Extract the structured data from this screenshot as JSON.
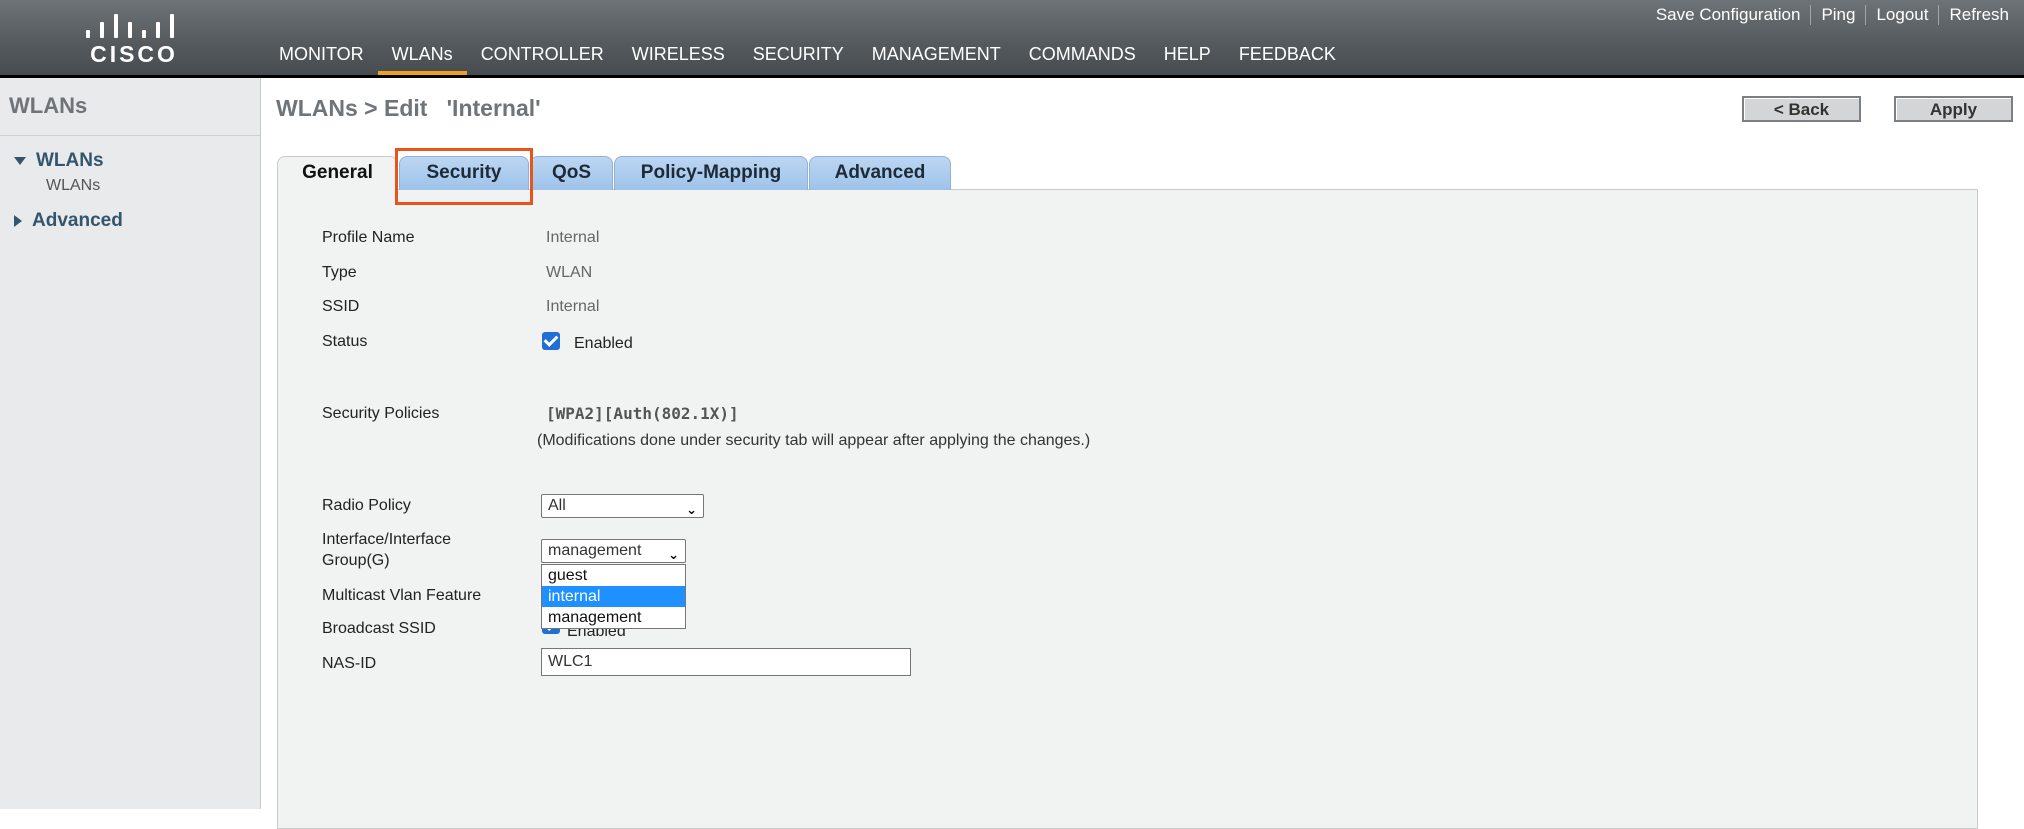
{
  "header": {
    "logo_text": "CISCO",
    "utility_links": [
      "Save Configuration",
      "Ping",
      "Logout",
      "Refresh"
    ],
    "nav": [
      "MONITOR",
      "WLANs",
      "CONTROLLER",
      "WIRELESS",
      "SECURITY",
      "MANAGEMENT",
      "COMMANDS",
      "HELP",
      "FEEDBACK"
    ],
    "active_nav": "WLANs",
    "accent_color": "#f0a020"
  },
  "sidebar": {
    "title": "WLANs",
    "items": [
      {
        "label": "WLANs",
        "expanded": true,
        "sub": "WLANs"
      },
      {
        "label": "Advanced",
        "expanded": false
      }
    ]
  },
  "main": {
    "title": "WLANs > Edit   'Internal'",
    "back_label": "< Back",
    "apply_label": "Apply",
    "tabs": [
      "General",
      "Security",
      "QoS",
      "Policy-Mapping",
      "Advanced"
    ],
    "active_tab": "General",
    "highlighted_tab": "Security",
    "highlight_color": "#e8541c"
  },
  "form": {
    "profile_name_label": "Profile Name",
    "profile_name": "Internal",
    "type_label": "Type",
    "type": "WLAN",
    "ssid_label": "SSID",
    "ssid": "Internal",
    "status_label": "Status",
    "status_checked": true,
    "status_text": "Enabled",
    "security_policies_label": "Security Policies",
    "security_policies": "[WPA2][Auth(802.1X)]",
    "security_note": "(Modifications done under security tab will appear after applying the changes.)",
    "radio_policy_label": "Radio Policy",
    "radio_policy": "All",
    "interface_label_1": "Interface/Interface",
    "interface_label_2": "Group(G)",
    "interface_value": "management",
    "interface_options": [
      "guest",
      "internal",
      "management"
    ],
    "interface_highlighted_option": "internal",
    "multicast_label": "Multicast Vlan Feature",
    "broadcast_label": "Broadcast SSID",
    "broadcast_checked": true,
    "broadcast_text": "Enabled",
    "nas_id_label": "NAS-ID",
    "nas_id": "WLC1"
  }
}
